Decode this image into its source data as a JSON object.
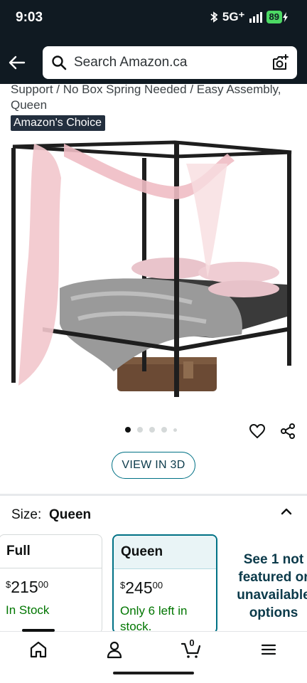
{
  "status_bar": {
    "time": "9:03",
    "network": "5G⁺",
    "battery": "89",
    "icons": [
      "bluetooth-icon",
      "signal-icon",
      "charging-icon"
    ]
  },
  "header": {
    "back_icon": "back-arrow-icon",
    "search_placeholder": "Search Amazon.ca",
    "camera_icon": "camera-search-icon"
  },
  "product": {
    "title_lines": [
      "Support / No Box Spring Needed / Easy Assembly,",
      "Queen"
    ],
    "badge": "Amazon's Choice",
    "image_icon": "canopy-bed-photo",
    "carousel": {
      "total": 5,
      "active_index": 0
    },
    "view_3d": "VIEW IN 3D"
  },
  "size_selector": {
    "label": "Size:",
    "selected": "Queen",
    "options": [
      {
        "name": "Full",
        "currency": "$",
        "whole": "215",
        "fraction": "00",
        "availability": "In Stock"
      },
      {
        "name": "Queen",
        "currency": "$",
        "whole": "245",
        "fraction": "00",
        "availability": "Only 6 left in stock."
      }
    ],
    "more_lines": [
      "See 1 not",
      "featured or",
      "unavailable",
      "options"
    ]
  },
  "bottom_nav": {
    "items": [
      "home-icon",
      "account-icon",
      "cart-icon",
      "menu-icon"
    ],
    "cart_count": "0"
  },
  "colors": {
    "header_bg": "#101a22",
    "link": "#007185",
    "in_stock": "#007600",
    "badge_bg": "#232f3e"
  }
}
